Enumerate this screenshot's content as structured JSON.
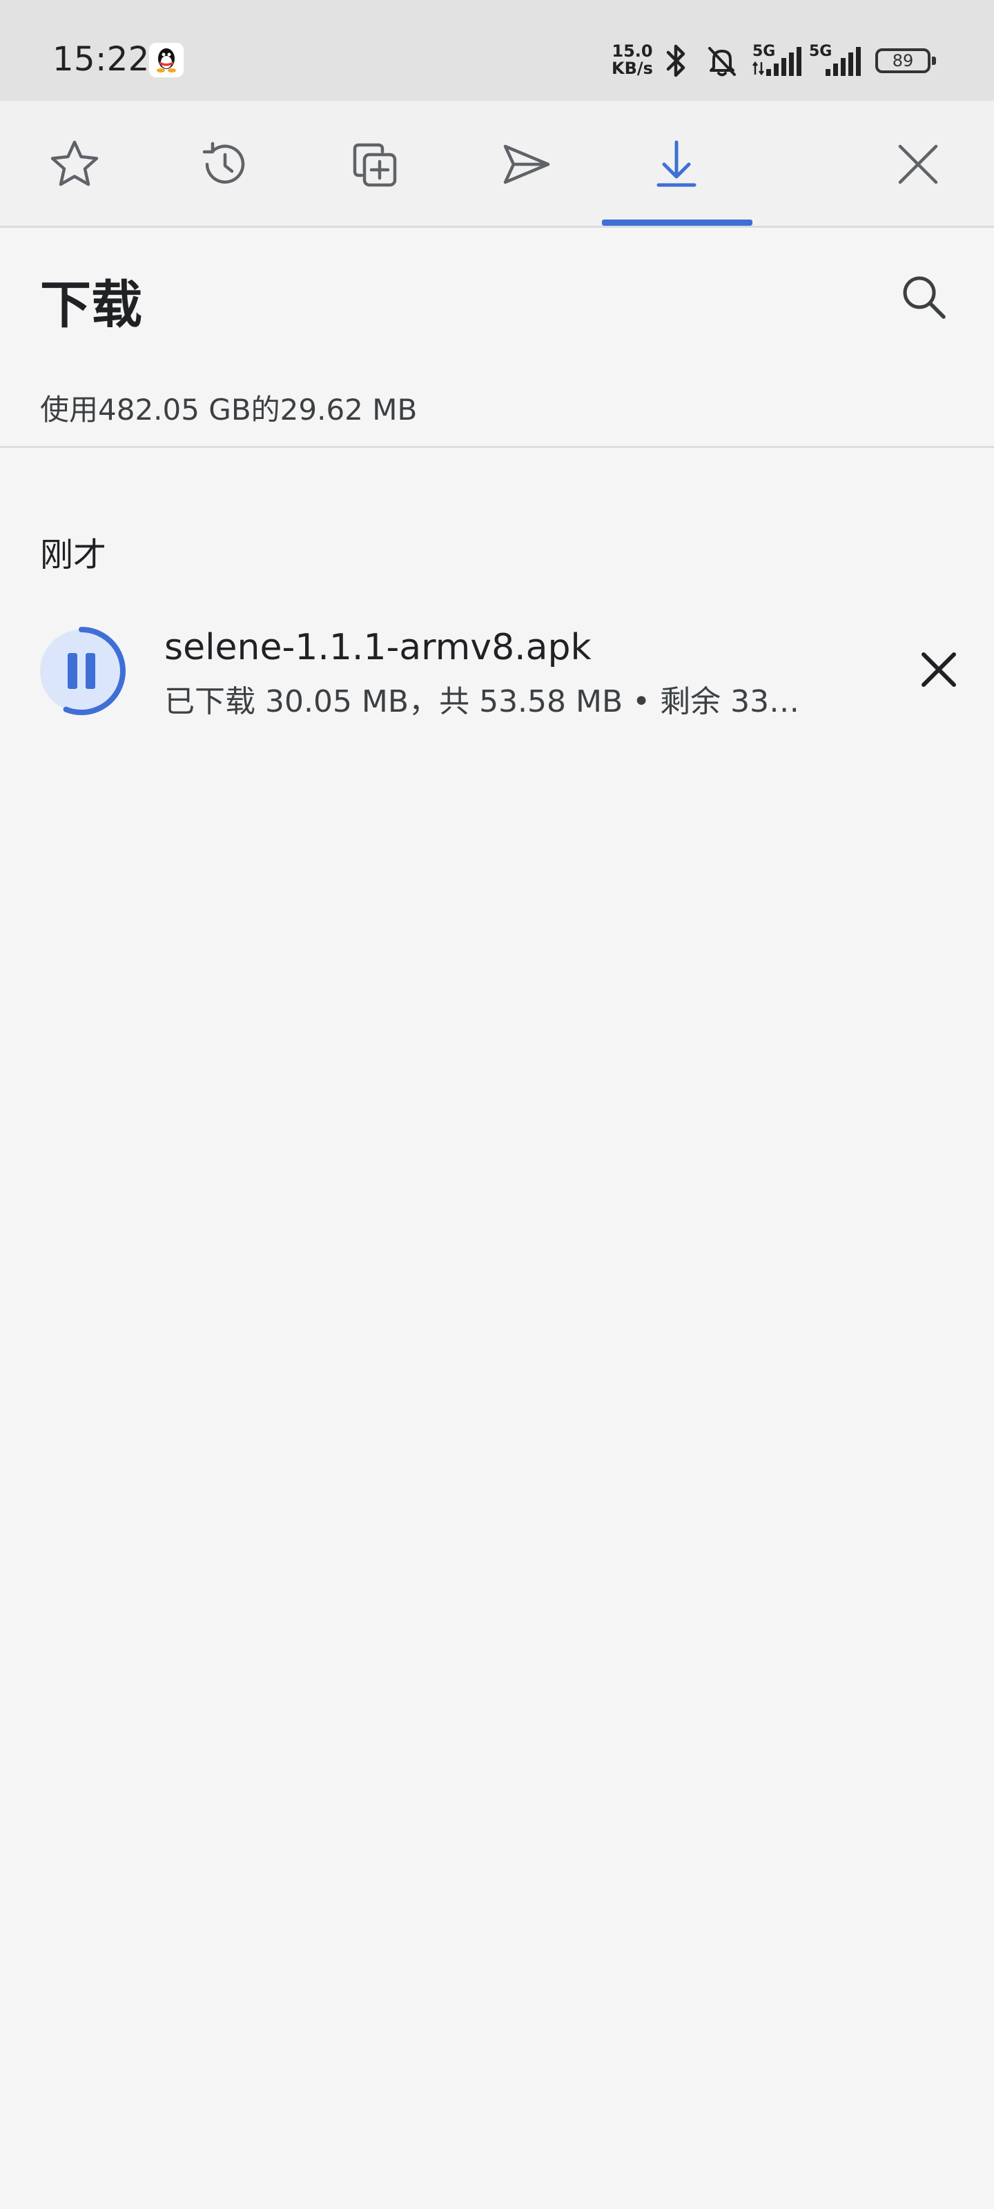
{
  "status_bar": {
    "time": "15:22",
    "net_speed_value": "15.0",
    "net_speed_unit": "KB/s",
    "sim1_label": "5G",
    "sim2_label": "5G",
    "battery_level": "89"
  },
  "toolbar": {
    "items": [
      {
        "name": "bookmarks",
        "icon": "star-icon"
      },
      {
        "name": "history",
        "icon": "history-icon"
      },
      {
        "name": "new-tab",
        "icon": "add-tab-icon"
      },
      {
        "name": "share",
        "icon": "send-icon"
      },
      {
        "name": "downloads",
        "icon": "download-icon",
        "selected": true
      },
      {
        "name": "close",
        "icon": "close-icon"
      }
    ],
    "accent_color": "#3f6fd6"
  },
  "header": {
    "title": "下载",
    "storage_info": "使用482.05 GB的29.62 MB"
  },
  "downloads": {
    "sections": [
      {
        "header": "刚才",
        "items": [
          {
            "file_name": "selene-1.1.1-armv8.apk",
            "status": "已下载 30.05 MB，共 53.58 MB • 剩余 33…",
            "downloaded_mb": 30.05,
            "total_mb": 53.58,
            "state": "downloading",
            "icon": "pause-icon"
          }
        ]
      }
    ]
  }
}
